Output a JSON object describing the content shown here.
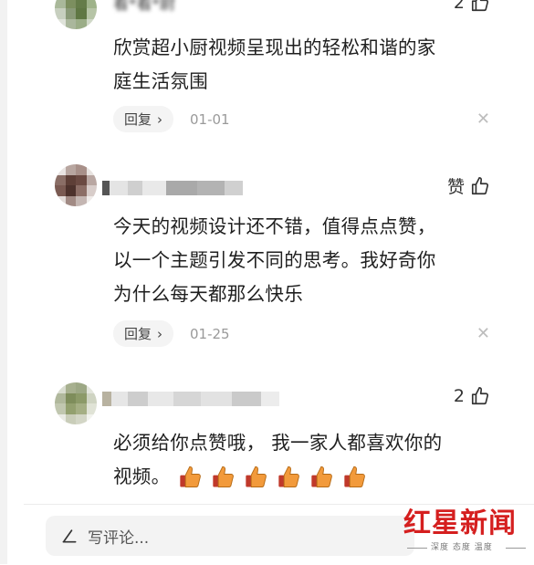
{
  "comments": [
    {
      "username": "看*看*尉",
      "likes": "2",
      "text_lines": [
        "欣赏超小厨视频呈现出的轻松和谐的家",
        "庭生活氛围"
      ],
      "reply_label": "回复",
      "date": "01-01"
    },
    {
      "username": "",
      "likes": "赞",
      "text_lines": [
        "今天的视频设计还不错，值得点点赞，",
        "以一个主题引发不同的思考。我好奇你",
        "为什么每天都那么快乐"
      ],
      "reply_label": "回复",
      "date": "01-25"
    },
    {
      "username": "",
      "likes": "2",
      "text_lines": [
        "必须给你点赞哦， 我一家人都喜欢你的",
        "视频。"
      ],
      "emoji_count": 6
    }
  ],
  "composer": {
    "placeholder": "写评论..."
  },
  "watermark": {
    "brand": "红星新闻",
    "tagline": "深度 态度 温度"
  },
  "colors": {
    "brand_red": "#d51f1f",
    "emoji_orange": "#f29a3b"
  }
}
